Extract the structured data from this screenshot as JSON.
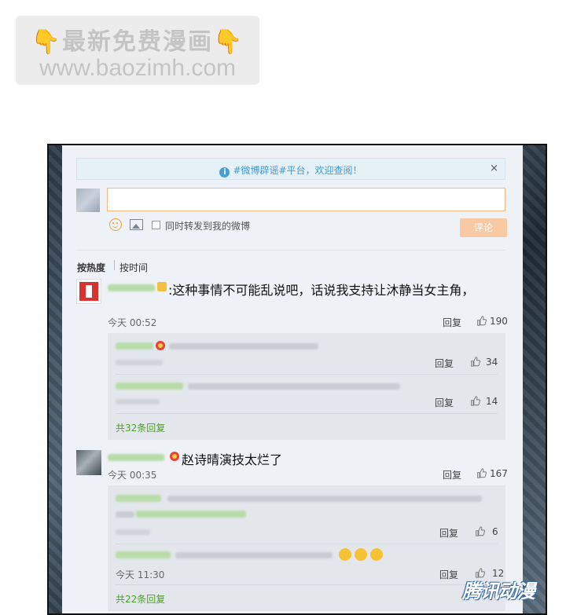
{
  "watermark": {
    "line1": "最新免费漫画",
    "line2": "www.baozimh.com",
    "hand_icon": "pointing-down-hand-icon"
  },
  "notice": {
    "text": "#微博辟谣#平台，欢迎查阅！",
    "info_icon": "info-icon",
    "close": "×"
  },
  "composer": {
    "input_value": "",
    "repost_label": "同时转发到我的微博",
    "submit_label": "评论",
    "emoji_icon": "smiley-icon",
    "image_icon": "image-icon"
  },
  "sort": {
    "hot_label": "按热度",
    "time_label": "按时间"
  },
  "comments": [
    {
      "text": "赵诗晴演技太烂了",
      "time": "今天 00:35",
      "reply_label": "回复",
      "likes": "167",
      "replies": [
        {
          "time": "",
          "reply_label": "回复",
          "likes": "6"
        },
        {
          "time": "今天 11:30",
          "reply_label": "回复",
          "likes": "12"
        }
      ],
      "more_label": "共22条回复"
    }
  ],
  "top_comment": {
    "text": ":这种事情不可能乱说吧，话说我支持让沐静当女主角，",
    "time": "今天 00:52",
    "reply_label": "回复",
    "likes": "190",
    "replies": [
      {
        "reply_label": "回复",
        "likes": "34"
      },
      {
        "reply_label": "回复",
        "likes": "14"
      }
    ],
    "more_label": "共32条回复"
  },
  "second_comment": {
    "text": "赵诗晴演技太烂了"
  },
  "brand_watermark": "腾讯动漫",
  "colors": {
    "notice_text": "#3f9ad6",
    "input_border": "#f5b87e",
    "submit_bg": "#f9c9a4",
    "more_link": "#4b9e2a"
  }
}
